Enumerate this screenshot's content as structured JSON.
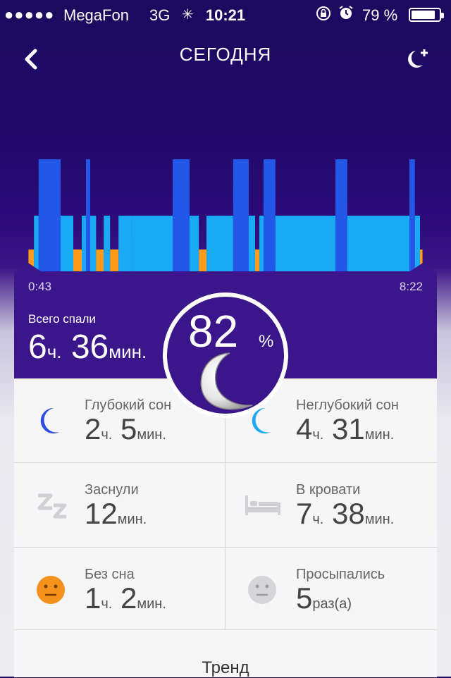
{
  "status_bar": {
    "signal": "●●●●●",
    "carrier": "MegaFon",
    "network": "3G",
    "time": "10:21",
    "battery_pct": "79 %",
    "battery_level": 0.79,
    "icons": [
      "activity-spinner-icon",
      "rotation-lock-icon",
      "alarm-icon",
      "battery-icon"
    ]
  },
  "nav": {
    "title": "СЕГОДНЯ",
    "back_icon": "chevron-left-icon",
    "right_icon": "moon-plus-icon"
  },
  "chart_data": {
    "type": "bar",
    "xlabel_start": "0:43",
    "xlabel_end": "8:22",
    "colors": {
      "deep": "#2357e8",
      "light": "#1aa9f5",
      "awake": "#ff9a1a"
    },
    "segments": [
      {
        "s": 0.034,
        "e": 0.047,
        "type": "awake"
      },
      {
        "s": 0.047,
        "e": 0.058,
        "type": "light"
      },
      {
        "s": 0.058,
        "e": 0.11,
        "type": "deep"
      },
      {
        "s": 0.11,
        "e": 0.14,
        "type": "light"
      },
      {
        "s": 0.14,
        "e": 0.16,
        "type": "awake"
      },
      {
        "s": 0.16,
        "e": 0.17,
        "type": "light"
      },
      {
        "s": 0.17,
        "e": 0.18,
        "type": "deep"
      },
      {
        "s": 0.18,
        "e": 0.194,
        "type": "light"
      },
      {
        "s": 0.194,
        "e": 0.212,
        "type": "awake"
      },
      {
        "s": 0.212,
        "e": 0.227,
        "type": "light"
      },
      {
        "s": 0.227,
        "e": 0.247,
        "type": "awake"
      },
      {
        "s": 0.247,
        "e": 0.279,
        "type": "light"
      },
      {
        "s": 0.279,
        "e": 0.375,
        "type": "light"
      },
      {
        "s": 0.375,
        "e": 0.415,
        "type": "deep"
      },
      {
        "s": 0.415,
        "e": 0.437,
        "type": "light"
      },
      {
        "s": 0.437,
        "e": 0.455,
        "type": "awake"
      },
      {
        "s": 0.455,
        "e": 0.518,
        "type": "light"
      },
      {
        "s": 0.518,
        "e": 0.555,
        "type": "deep"
      },
      {
        "s": 0.555,
        "e": 0.57,
        "type": "light"
      },
      {
        "s": 0.57,
        "e": 0.58,
        "type": "awake"
      },
      {
        "s": 0.58,
        "e": 0.59,
        "type": "light"
      },
      {
        "s": 0.59,
        "e": 0.618,
        "type": "deep"
      },
      {
        "s": 0.618,
        "e": 0.76,
        "type": "light"
      },
      {
        "s": 0.76,
        "e": 0.788,
        "type": "deep"
      },
      {
        "s": 0.788,
        "e": 0.935,
        "type": "light"
      },
      {
        "s": 0.935,
        "e": 0.948,
        "type": "deep"
      },
      {
        "s": 0.948,
        "e": 0.96,
        "type": "light"
      },
      {
        "s": 0.96,
        "e": 0.966,
        "type": "awake"
      }
    ]
  },
  "summary": {
    "total_label": "Всего спали",
    "total_hours": "6",
    "total_hours_unit": "ч.",
    "total_minutes": "36",
    "total_minutes_unit": "мин.",
    "score": "82",
    "score_unit": "%"
  },
  "stats": [
    {
      "label": "Глубокий сон",
      "v1": "2",
      "u1": "ч.",
      "v2": "5",
      "u2": "мин.",
      "icon": "deep-sleep-moon-icon"
    },
    {
      "label": "Неглубокий сон",
      "v1": "4",
      "u1": "ч.",
      "v2": "31",
      "u2": "мин.",
      "icon": "light-sleep-moon-icon"
    },
    {
      "label": "Заснули",
      "v1": "12",
      "u1": "мин.",
      "icon": "zz-icon"
    },
    {
      "label": "В кровати",
      "v1": "7",
      "u1": "ч.",
      "v2": "38",
      "u2": "мин.",
      "icon": "bed-icon"
    },
    {
      "label": "Без сна",
      "v1": "1",
      "u1": "ч.",
      "v2": "2",
      "u2": "мин.",
      "icon": "awake-face-icon"
    },
    {
      "label": "Просыпались",
      "v1": "5",
      "u1": "раз(а)",
      "icon": "woke-up-face-icon"
    }
  ],
  "trend_label": "Тренд"
}
